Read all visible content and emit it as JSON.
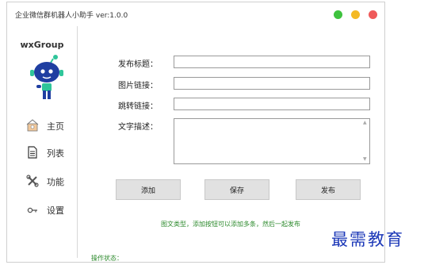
{
  "window": {
    "title": "企业微信群机器人小助手 ver:1.0.0",
    "controls": [
      {
        "name": "minimize",
        "color": "#3ec23e"
      },
      {
        "name": "maximize",
        "color": "#f4b925"
      },
      {
        "name": "close",
        "color": "#ef5a5a"
      }
    ]
  },
  "sidebar": {
    "brand": "wxGroup",
    "items": [
      {
        "label": "主页",
        "icon": "home-icon"
      },
      {
        "label": "列表",
        "icon": "document-icon"
      },
      {
        "label": "功能",
        "icon": "tools-icon"
      },
      {
        "label": "设置",
        "icon": "key-icon"
      }
    ]
  },
  "form": {
    "title_label": "发布标题：",
    "title_value": "",
    "image_label": "图片链接：",
    "image_value": "",
    "jump_label": "跳转链接：",
    "jump_value": "",
    "desc_label": "文字描述：",
    "desc_value": ""
  },
  "buttons": {
    "add": "添加",
    "save": "保存",
    "publish": "发布"
  },
  "hint": "图文类型，添加按钮可以添加多条，然后一起发布",
  "status": {
    "label": "操作状态：",
    "value": ""
  },
  "watermark": "最需教育",
  "colors": {
    "accent_green": "#2c8a2c",
    "watermark_blue": "#1d39b8"
  }
}
